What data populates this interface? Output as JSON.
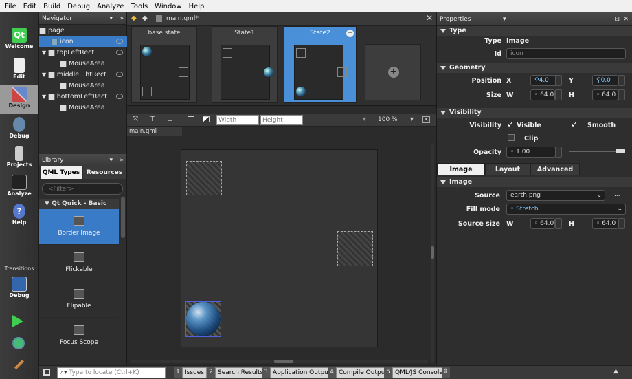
{
  "menu": [
    "File",
    "Edit",
    "Build",
    "Debug",
    "Analyze",
    "Tools",
    "Window",
    "Help"
  ],
  "modes": [
    "Welcome",
    "Edit",
    "Design",
    "Debug",
    "Projects",
    "Analyze",
    "Help"
  ],
  "transitions_label": "Transitions",
  "transitions_debug": "Debug",
  "navigator": {
    "title": "Navigator",
    "items": [
      {
        "label": "page"
      },
      {
        "label": "icon"
      },
      {
        "label": "topLeftRect"
      },
      {
        "label": "MouseArea"
      },
      {
        "label": "middle...htRect"
      },
      {
        "label": "MouseArea"
      },
      {
        "label": "bottomLeftRect"
      },
      {
        "label": "MouseArea"
      }
    ]
  },
  "library": {
    "title": "Library",
    "tabs": [
      "QML Types",
      "Resources"
    ],
    "filter_placeholder": "<Filter>",
    "section": "Qt Quick - Basic",
    "items": [
      "Border Image",
      "Flickable",
      "Flipable",
      "Focus Scope"
    ]
  },
  "editor": {
    "file": "main.qml*",
    "crumb": "main.qml",
    "width_placeholder": "Width",
    "height_placeholder": "Height",
    "zoom": "100 %",
    "states": [
      "base state",
      "State1",
      "State2"
    ]
  },
  "properties": {
    "title": "Properties",
    "type_section": "Type",
    "type_label": "Type",
    "type_value": "Image",
    "id_label": "Id",
    "id_value": "icon",
    "geometry_section": "Geometry",
    "position_label": "Position",
    "x_label": "X",
    "x_value": "4.0",
    "y_label": "Y",
    "y_value": "0.0",
    "size_label": "Size",
    "w_label": "W",
    "w_value": "64.0",
    "h_label": "H",
    "h_value": "64.0",
    "visibility_section": "Visibility",
    "visibility_label": "Visibility",
    "visible_label": "Visible",
    "smooth_label": "Smooth",
    "clip_label": "Clip",
    "opacity_label": "Opacity",
    "opacity_value": "1.00",
    "tabs": [
      "Image",
      "Layout",
      "Advanced"
    ],
    "image_section": "Image",
    "source_label": "Source",
    "source_value": "earth.png",
    "more": "...",
    "fillmode_label": "Fill mode",
    "fillmode_value": "Stretch",
    "sourcesize_label": "Source size",
    "ss_w_value": "64.0",
    "ss_h_value": "64.0"
  },
  "status": {
    "locate_placeholder": "Type to locate (Ctrl+K)",
    "outputs": [
      {
        "num": "1",
        "label": "Issues"
      },
      {
        "num": "2",
        "label": "Search Results"
      },
      {
        "num": "3",
        "label": "Application Output"
      },
      {
        "num": "4",
        "label": "Compile Output"
      },
      {
        "num": "5",
        "label": "QML/JS Console"
      }
    ]
  },
  "colors": {
    "accent": "#3a7bc8",
    "qt_green": "#41cd52"
  }
}
